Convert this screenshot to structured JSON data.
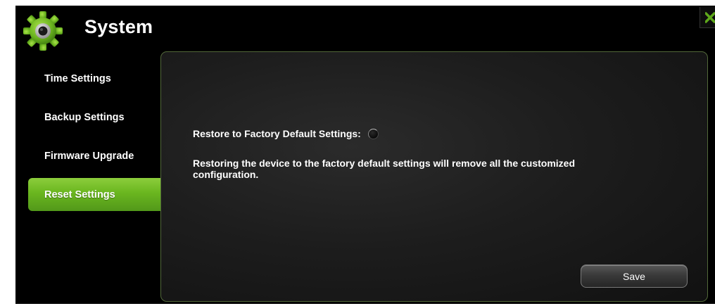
{
  "app": {
    "title": "System",
    "icon": "gear-icon",
    "close_icon": "close-icon"
  },
  "colors": {
    "accent_green": "#6ab61f",
    "panel_border": "#52683a",
    "background": "#000000"
  },
  "sidebar": {
    "items": [
      {
        "label": "Time Settings",
        "active": false
      },
      {
        "label": "Backup Settings",
        "active": false
      },
      {
        "label": "Firmware Upgrade",
        "active": false
      },
      {
        "label": "Reset Settings",
        "active": true
      }
    ]
  },
  "reset": {
    "restore_label": "Restore to Factory Default Settings:",
    "restore_selected": false,
    "description": "Restoring the device to the factory default settings will remove all the customized configuration."
  },
  "actions": {
    "save_label": "Save"
  }
}
